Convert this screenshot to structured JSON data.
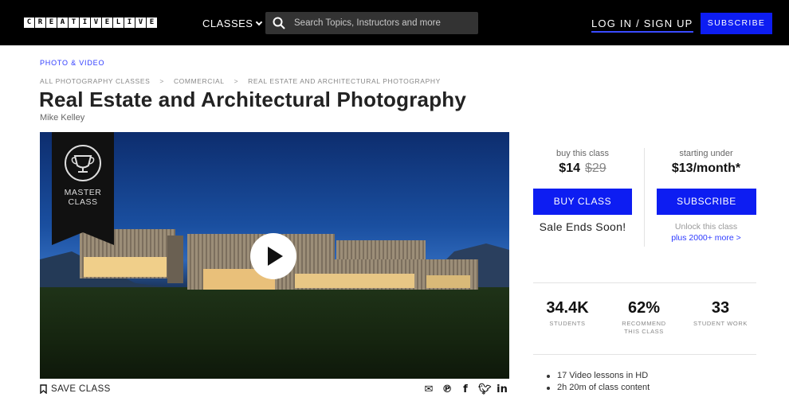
{
  "header": {
    "logo_letters": [
      "C",
      "R",
      "E",
      "A",
      "T",
      "I",
      "V",
      "E",
      "L",
      "I",
      "V",
      "E"
    ],
    "classes_label": "CLASSES",
    "search_placeholder": "Search Topics, Instructors and more",
    "login_label": "LOG IN / SIGN UP",
    "subscribe_label": "SUBSCRIBE"
  },
  "category": "PHOTO & VIDEO",
  "breadcrumb": [
    "ALL PHOTOGRAPHY CLASSES",
    "COMMERCIAL",
    "REAL ESTATE AND ARCHITECTURAL PHOTOGRAPHY"
  ],
  "breadcrumb_sep": ">",
  "title": "Real Estate and Architectural Photography",
  "instructor": "Mike Kelley",
  "video": {
    "badge_line1": "MASTER",
    "badge_line2": "CLASS"
  },
  "save_label": "SAVE CLASS",
  "purchase": {
    "buy_caption": "buy this class",
    "buy_price": "$14",
    "buy_old_price": "$29",
    "buy_button": "BUY CLASS",
    "sale_text": "Sale Ends Soon!",
    "sub_caption": "starting under",
    "sub_price": "$13/month*",
    "sub_button": "SUBSCRIBE",
    "unlock_text": "Unlock this class",
    "unlock_link": "plus 2000+ more >"
  },
  "stats": [
    {
      "value": "34.4K",
      "label": "STUDENTS"
    },
    {
      "value": "62%",
      "label": "RECOMMEND THIS CLASS"
    },
    {
      "value": "33",
      "label": "STUDENT WORK"
    }
  ],
  "features": [
    "17 Video lessons in HD",
    "2h 20m of class content"
  ],
  "colors": {
    "accent": "#0d1df2",
    "link": "#2f3cff"
  }
}
